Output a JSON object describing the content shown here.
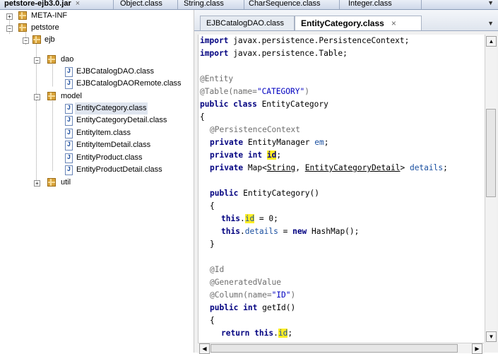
{
  "top_tabs": [
    {
      "label": "petstore-ejb3.0.jar",
      "active": true
    },
    {
      "label": "Object.class"
    },
    {
      "label": "String.class"
    },
    {
      "label": "CharSequence.class"
    },
    {
      "label": "Integer.class"
    }
  ],
  "close_glyph": "×",
  "menu_arrow": "▼",
  "tree": {
    "meta_inf": "META-INF",
    "petstore": "petstore",
    "ejb": "ejb",
    "dao": "dao",
    "dao_files": [
      "EJBCatalogDAO.class",
      "EJBCatalogDAORemote.class"
    ],
    "model": "model",
    "model_files": [
      "EntityCategory.class",
      "EntityCategoryDetail.class",
      "EntityItem.class",
      "EntityItemDetail.class",
      "EntityProduct.class",
      "EntityProductDetail.class"
    ],
    "util": "util",
    "selected": "EntityCategory.class",
    "file_icon_glyph": "J",
    "expanded_glyph": "−",
    "collapsed_glyph": "+"
  },
  "editor_tabs": [
    {
      "label": "EJBCatalogDAO.class"
    },
    {
      "label": "EntityCategory.class",
      "active": true
    }
  ],
  "code": {
    "l1_kw": "import",
    "l1_rest": " javax.persistence.PersistenceContext;",
    "l2_kw": "import",
    "l2_rest": " javax.persistence.Table;",
    "l3": "@Entity",
    "l4_a": "@Table(name=",
    "l4_s": "\"CATEGORY\"",
    "l4_b": ")",
    "l5_kw": "public class",
    "l5_rest": " EntityCategory",
    "l6": "{",
    "l7": "@PersistenceContext",
    "l8_kw": "private",
    "l8_rest": " EntityManager ",
    "l8_f": "em",
    "l8_end": ";",
    "l9_kw": "private int",
    "l9_sp": " ",
    "l9_h": "id",
    "l9_end": ";",
    "l10_kw": "private",
    "l10_a": " Map<",
    "l10_u1": "String",
    "l10_b": ", ",
    "l10_u2": "EntityCategoryDetail",
    "l10_c": "> ",
    "l10_f": "details",
    "l10_end": ";",
    "l11_kw": "public",
    "l11_rest": " EntityCategory()",
    "l12": "{",
    "l13_kw": "this",
    "l13_dot": ".",
    "l13_h": "id",
    "l13_rest": " = 0;",
    "l14_kw": "this",
    "l14_dot": ".",
    "l14_f": "details",
    "l14_a": " = ",
    "l14_kw2": "new",
    "l14_rest": " HashMap();",
    "l15": "}",
    "l16": "@Id",
    "l17": "@GeneratedValue",
    "l18_a": "@Column(name=",
    "l18_s": "\"ID\"",
    "l18_b": ")",
    "l19_kw": "public int",
    "l19_rest": " getId()",
    "l20": "{",
    "l21_kw": "return this",
    "l21_dot": ".",
    "l21_h": "id",
    "l21_end": ";"
  },
  "scroll": {
    "up": "▲",
    "down": "▼",
    "left": "◀",
    "right": "▶"
  },
  "colors": {
    "keyword": "#000080",
    "annotation": "#6e6e6e",
    "string": "#0000c0",
    "field": "#1a4fa0",
    "highlight": "#ffee22",
    "package_icon": "#d9a43c"
  }
}
